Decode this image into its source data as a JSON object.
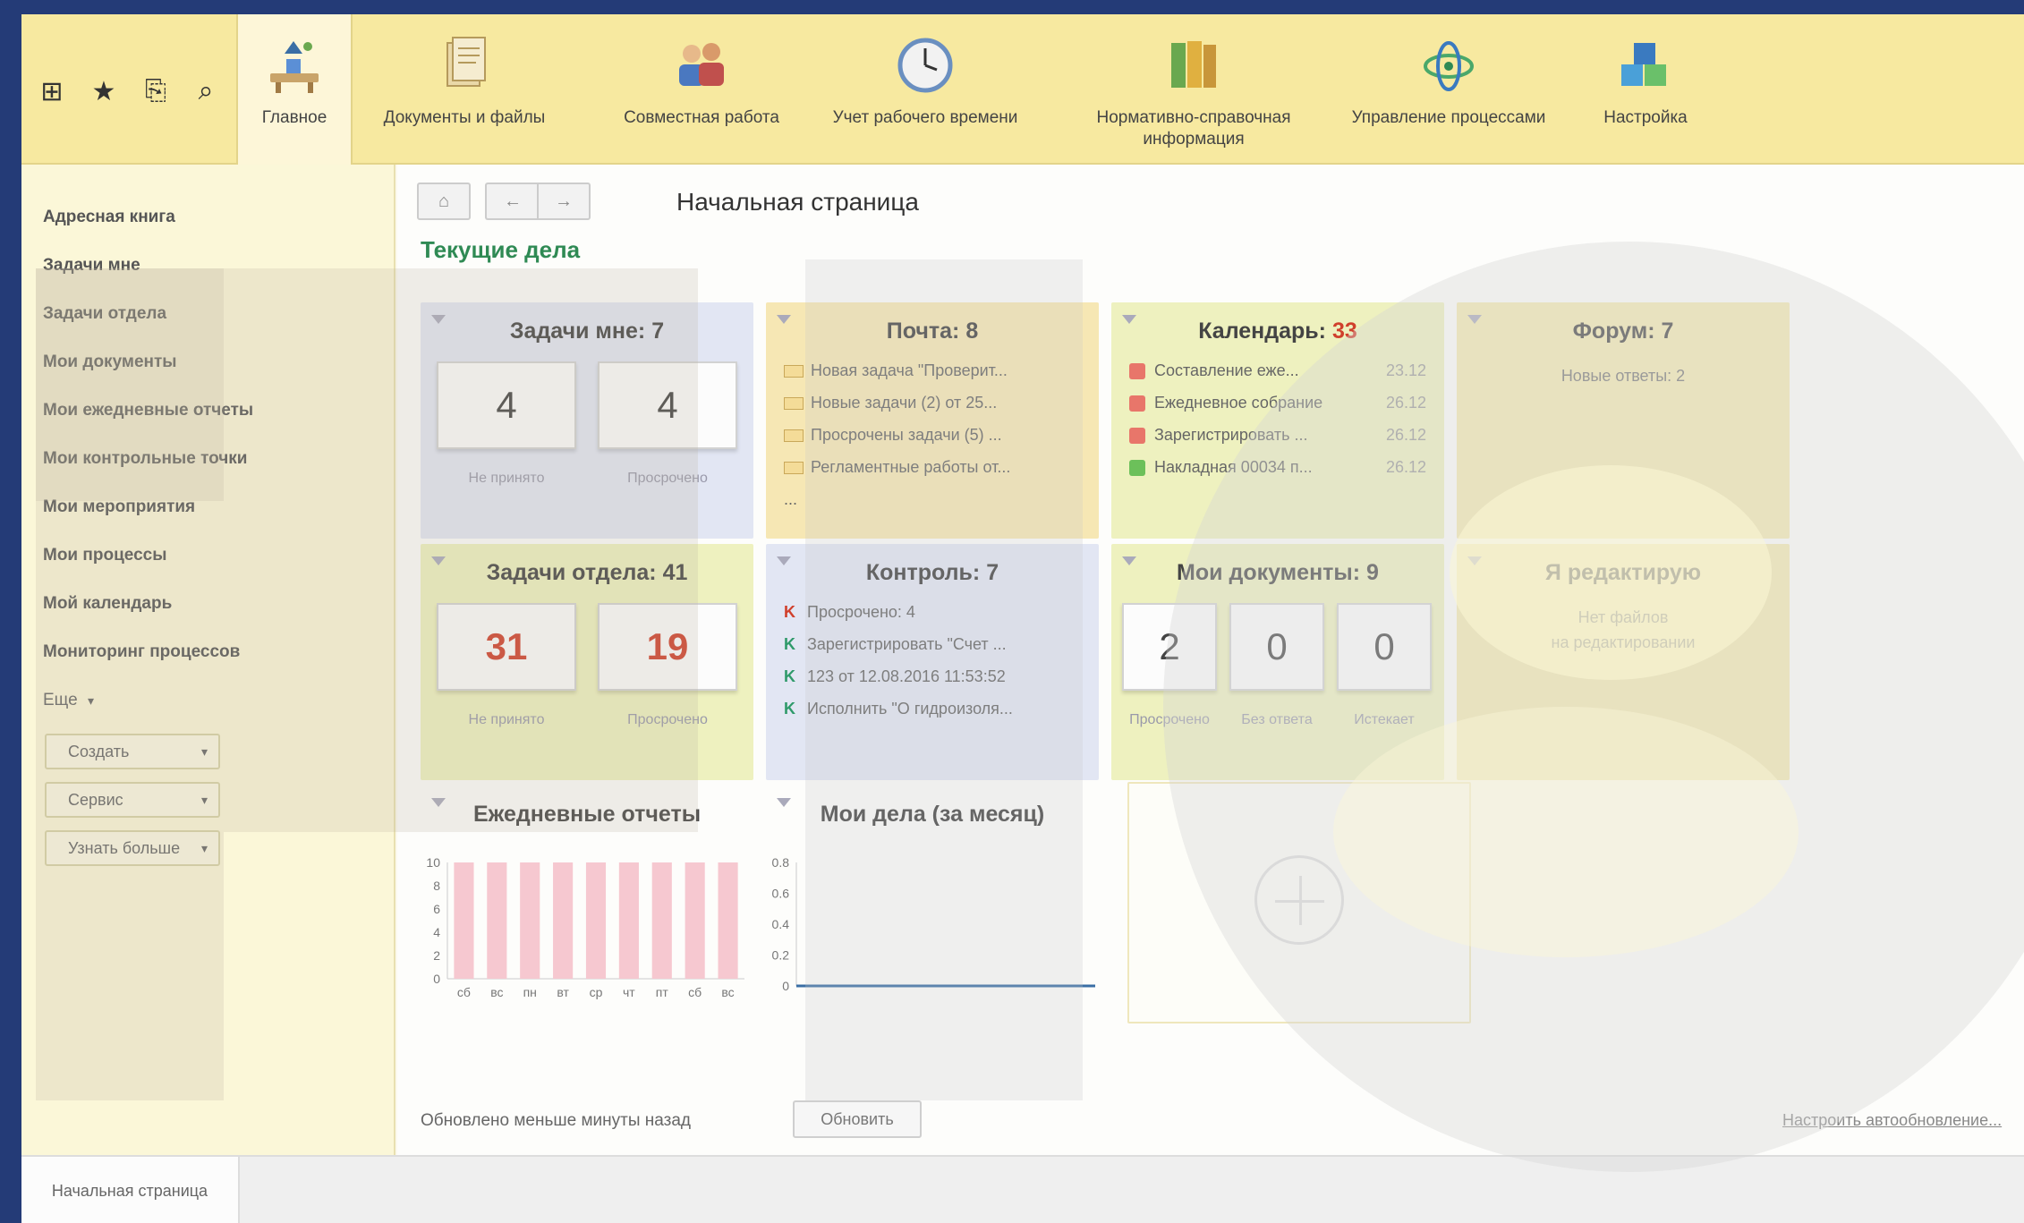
{
  "toolbar": {
    "icons": [
      "grid-icon",
      "star-icon",
      "history-icon",
      "search-icon"
    ],
    "grid_glyph": "⊞",
    "star_glyph": "★",
    "history_glyph": "⎘",
    "search_glyph": "⌕"
  },
  "sections": [
    {
      "label": "Главное",
      "icon": "home-desk-icon"
    },
    {
      "label": "Документы и файлы",
      "icon": "documents-icon"
    },
    {
      "label": "Совместная работа",
      "icon": "people-icon"
    },
    {
      "label": "Учет рабочего времени",
      "icon": "clock-icon"
    },
    {
      "label": "Нормативно-справочная\nинформация",
      "icon": "binders-icon"
    },
    {
      "label": "Управление процессами",
      "icon": "process-icon"
    },
    {
      "label": "Настройка",
      "icon": "settings-cubes-icon"
    }
  ],
  "sidebar": {
    "items": [
      "Адресная книга",
      "Задачи мне",
      "Задачи отдела",
      "Мои документы",
      "Мои ежедневные отчеты",
      "Мои контрольные точки",
      "Мои мероприятия",
      "Мои процессы",
      "Мой календарь",
      "Мониторинг процессов"
    ],
    "more_label": "Еще",
    "more_arrow": "▾",
    "buttons": [
      "Создать",
      "Сервис",
      "Узнать больше"
    ],
    "dropdown_arrow": "▾"
  },
  "nav": {
    "home_glyph": "⌂",
    "back_glyph": "←",
    "forward_glyph": "→"
  },
  "page_title": "Начальная страница",
  "section_title": "Текущие дела",
  "widgets": {
    "tasks_me": {
      "title": "Задачи мне: ",
      "count": "7",
      "c1": "4",
      "c2": "4",
      "l1": "Не принято",
      "l2": "Просрочено"
    },
    "mail": {
      "title": "Почта: ",
      "count": "8",
      "items": [
        "Новая задача \"Проверит...",
        "Новые задачи (2) от 25...",
        "Просрочены задачи (5) ...",
        "Регламентные работы от..."
      ],
      "more": "..."
    },
    "calendar": {
      "title": "Календарь: ",
      "count": "33",
      "items": [
        {
          "text": "Составление еже...",
          "date": "23.12",
          "color": "#e8766a"
        },
        {
          "text": "Ежедневное собрание",
          "date": "26.12",
          "color": "#e8766a"
        },
        {
          "text": "Зарегистрировать ...",
          "date": "26.12",
          "color": "#e8766a"
        },
        {
          "text": "Накладная 00034 п...",
          "date": "26.12",
          "color": "#6cc05a"
        }
      ]
    },
    "forum": {
      "title": "Форум: ",
      "count": "7",
      "sub": "Новые ответы: 2"
    },
    "tasks_dept": {
      "title": "Задачи отдела: ",
      "count": "41",
      "c1": "31",
      "c2": "19",
      "l1": "Не принято",
      "l2": "Просрочено"
    },
    "control": {
      "title": "Контроль: ",
      "count": "7",
      "items": [
        {
          "text": "Просрочено: 4",
          "mark": "K",
          "color": "#d0402c"
        },
        {
          "text": "Зарегистрировать \"Счет ...",
          "mark": "K",
          "color": "#2f9a6a"
        },
        {
          "text": "123 от 12.08.2016 11:53:52",
          "mark": "K",
          "color": "#2f9a6a"
        },
        {
          "text": "Исполнить \"О гидроизоля...",
          "mark": "K",
          "color": "#2f9a6a"
        }
      ]
    },
    "my_docs": {
      "title": "Мои документы: ",
      "count": "9",
      "c1": "2",
      "c2": "0",
      "c3": "0",
      "l1": "Просрочено",
      "l2": "Без ответа",
      "l3": "Истекает"
    },
    "editing": {
      "title": "Я редактирую",
      "sub": "Нет файлов\nна редактировании"
    },
    "daily_reports": {
      "title": "Ежедневные отчеты"
    },
    "my_affairs": {
      "title": "Мои дела (за месяц)"
    }
  },
  "charts": {
    "daily": {
      "type": "bar",
      "categories": [
        "сб",
        "вс",
        "пн",
        "вт",
        "ср",
        "чт",
        "пт",
        "сб",
        "вс"
      ],
      "values": [
        10,
        10,
        10,
        10,
        10,
        10,
        10,
        10,
        10
      ],
      "ylim": [
        0,
        10
      ],
      "yticks": [
        0,
        2,
        4,
        6,
        8,
        10
      ],
      "color": "#f6c8d0"
    },
    "affairs": {
      "type": "line",
      "values": [
        0,
        0
      ],
      "ylim": [
        0,
        0.8
      ],
      "yticks": [
        0,
        0.2,
        0.4,
        0.6,
        0.8
      ],
      "color": "#3a6ea5"
    }
  },
  "footer": {
    "updated": "Обновлено меньше минуты назад",
    "refresh": "Обновить",
    "autorefresh": "Настроить автообновление..."
  },
  "bottom_tab": "Начальная страница",
  "colors": {
    "accent_green": "#2f8a54",
    "alert_red": "#d0402c",
    "topbar_yellow": "#f7e9a0"
  }
}
